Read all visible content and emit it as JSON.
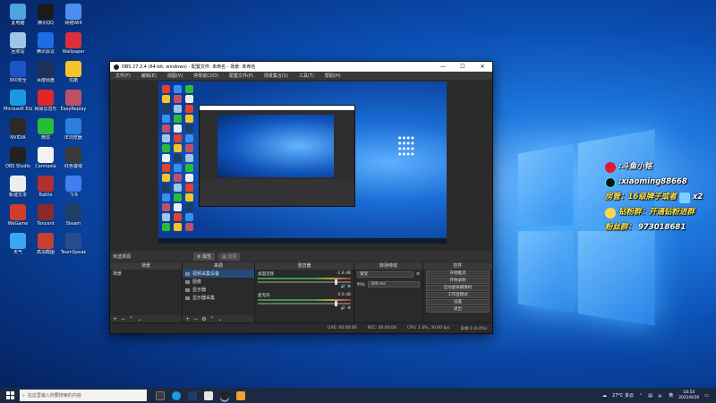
{
  "desktop": {
    "icons": [
      {
        "label": "此电脑",
        "icon": "computer-icon",
        "color": "#4fa3e0"
      },
      {
        "label": "腾讯QQ",
        "icon": "qq-icon",
        "color": "#1b1b1b"
      },
      {
        "label": "网络Wifi",
        "icon": "network-icon",
        "color": "#4d8ef0"
      },
      {
        "label": "回收站",
        "icon": "recycle-bin-icon",
        "color": "#9fc6e8"
      },
      {
        "label": "腾讯会议",
        "icon": "meeting-icon",
        "color": "#1e6be6"
      },
      {
        "label": "Wallpaper",
        "icon": "wallpaper-icon",
        "color": "#d9303a"
      },
      {
        "label": "360安全",
        "icon": "security-icon",
        "color": "#1d54c8"
      },
      {
        "label": "百度网盘",
        "icon": "baidu-netdisk-icon",
        "color": "#1f2f55"
      },
      {
        "label": "优酷",
        "icon": "youku-icon",
        "color": "#f4c52a"
      },
      {
        "label": "Microsoft Edge",
        "icon": "edge-icon",
        "color": "#1b9ae0"
      },
      {
        "label": "网易云音乐",
        "icon": "netease-music-icon",
        "color": "#e0252b"
      },
      {
        "label": "EasyReplay",
        "icon": "anime-icon",
        "color": "#c0506a"
      },
      {
        "label": "NVIDIA",
        "icon": "nvidia-icon",
        "color": "#2a2a2a"
      },
      {
        "label": "微信",
        "icon": "wechat-icon",
        "color": "#2bbb3a"
      },
      {
        "label": "IE浏览器",
        "icon": "ie-icon",
        "color": "#2b7fe0"
      },
      {
        "label": "OBS Studio",
        "icon": "obs-icon",
        "color": "#222"
      },
      {
        "label": "Camtasia",
        "icon": "document-icon",
        "color": "#f2f2f2"
      },
      {
        "label": "红色警戒",
        "icon": "game-icon",
        "color": "#3a3a3a"
      },
      {
        "label": "新建文本",
        "icon": "file-icon",
        "color": "#eeeeee"
      },
      {
        "label": "Battle",
        "icon": "brick-game-icon",
        "color": "#b03030"
      },
      {
        "label": "飞书",
        "icon": "feishu-icon",
        "color": "#3f7ff0"
      },
      {
        "label": "WeGame",
        "icon": "wegame-icon",
        "color": "#d23d2b"
      },
      {
        "label": "Tencent",
        "icon": "tencent-game-icon",
        "color": "#8a2b2b"
      },
      {
        "label": "Steam",
        "icon": "steam-icon",
        "color": "#1f3e66"
      },
      {
        "label": "天气",
        "icon": "cloud-icon",
        "color": "#3ca8f0"
      },
      {
        "label": "高清截图",
        "icon": "screenshot-icon",
        "color": "#c7402e"
      },
      {
        "label": "TeamSpeak",
        "icon": "teamspeak-icon",
        "color": "#2a4c8c"
      }
    ]
  },
  "obs": {
    "title": "OBS 27.2.4 (64-bit, windows) - 配置文件: 未命名 - 场景: 未命名",
    "minimize": "—",
    "maximize": "☐",
    "close": "✕",
    "menu": [
      "文件(F)",
      "编辑(E)",
      "视图(V)",
      "停靠窗口(D)",
      "配置文件(P)",
      "场景集合(S)",
      "工具(T)",
      "帮助(H)"
    ],
    "scene_label": "未选择源",
    "properties_btn": "属性",
    "filters_btn": "滤镜",
    "docks": {
      "scenes": {
        "title": "场景",
        "items": [
          "场景"
        ]
      },
      "sources": {
        "title": "来源",
        "items": [
          "视频采集设备",
          "图像",
          "显示器",
          "显示器采集"
        ]
      },
      "mixer": {
        "title": "混音器",
        "channels": [
          {
            "name": "桌面音频",
            "db": "-1.6 dB"
          },
          {
            "name": "麦克风",
            "db": "0.0 dB"
          }
        ]
      },
      "transitions": {
        "title": "转场特效",
        "type": "渐变",
        "duration_label": "时长",
        "duration": "300 ms"
      },
      "controls": {
        "title": "控件",
        "buttons": [
          "开始推流",
          "开始录制",
          "启动虚拟摄像机",
          "工作室模式",
          "设置",
          "退出"
        ]
      }
    },
    "status": {
      "live": "LIVE: 00:00:00",
      "rec": "REC: 00:00:00",
      "cpu": "CPU: 1.4%, 30.00 fps",
      "drop": "丢帧 0 (0.0%)"
    }
  },
  "overlay": {
    "lines": [
      {
        "icon": "weibo-icon",
        "text": ":斗鱼小铭"
      },
      {
        "icon": "tiktok-icon",
        "text": ":xiaoming88668"
      },
      {
        "icon": "",
        "text": "房管：16级牌子或者",
        "suffix": "x2"
      },
      {
        "icon": "fan-group-icon",
        "text": "钻粉群：开通钻粉进群"
      },
      {
        "icon": "",
        "text": "粉丝群：",
        "value": "973018681"
      }
    ]
  },
  "taskbar": {
    "search_placeholder": "在这里输入你要搜索的内容",
    "weather": "27°C 多云",
    "lang": "英",
    "time": "18:54",
    "date": "2022/6/20"
  }
}
